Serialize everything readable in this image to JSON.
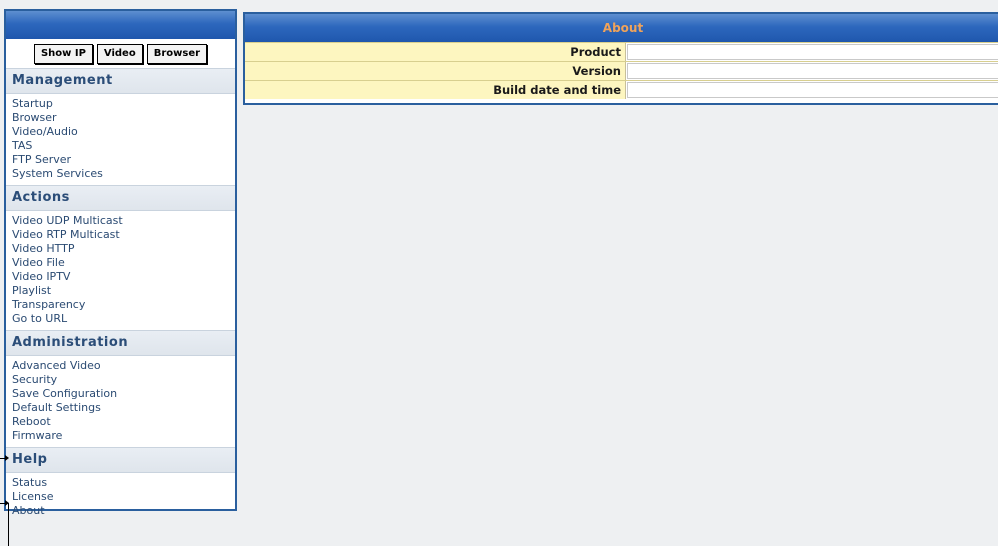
{
  "toolbar": {
    "show_ip_label": "Show IP",
    "video_label": "Video",
    "browser_label": "Browser"
  },
  "sections": {
    "management": {
      "title": "Management",
      "items": [
        "Startup",
        "Browser",
        "Video/Audio",
        "TAS",
        "FTP Server",
        "System Services"
      ]
    },
    "actions": {
      "title": "Actions",
      "items": [
        "Video UDP Multicast",
        "Video RTP Multicast",
        "Video HTTP",
        "Video File",
        "Video IPTV",
        "Playlist",
        "Transparency",
        "Go to URL"
      ]
    },
    "administration": {
      "title": "Administration",
      "items": [
        "Advanced Video",
        "Security",
        "Save Configuration",
        "Default Settings",
        "Reboot",
        "Firmware"
      ]
    },
    "help": {
      "title": "Help",
      "items": [
        "Status",
        "License",
        "About"
      ]
    }
  },
  "about": {
    "title": "About",
    "rows": [
      {
        "label": "Product",
        "value": ""
      },
      {
        "label": "Version",
        "value": ""
      },
      {
        "label": "Build date and time",
        "value": ""
      }
    ]
  },
  "colors": {
    "header_blue": "#2d67bd",
    "header_text_orange": "#f0a35a",
    "label_yellow": "#fdf6c0",
    "section_text": "#2b4d78"
  }
}
